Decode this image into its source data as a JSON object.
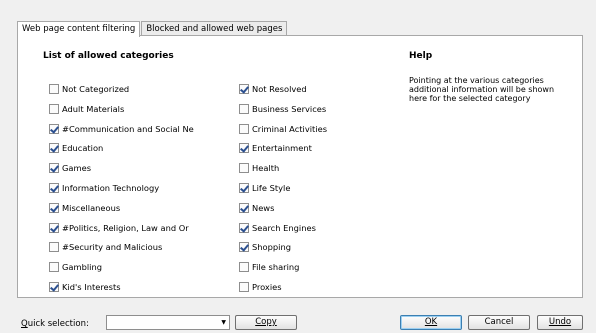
{
  "tabs": [
    {
      "label": "Web page content filtering",
      "active": true
    },
    {
      "label": "Blocked and allowed web pages",
      "active": false
    }
  ],
  "categories_title": "List of allowed categories",
  "left_column": [
    {
      "label": "Not Categorized",
      "checked": false
    },
    {
      "label": "Adult Materials",
      "checked": false
    },
    {
      "label": "#Communication and Social Ne",
      "checked": true
    },
    {
      "label": "Education",
      "checked": true
    },
    {
      "label": "Games",
      "checked": true
    },
    {
      "label": "Information Technology",
      "checked": true
    },
    {
      "label": "Miscellaneous",
      "checked": true
    },
    {
      "label": "#Politics, Religion, Law and Or",
      "checked": true
    },
    {
      "label": "#Security and Malicious",
      "checked": false
    },
    {
      "label": "Gambling",
      "checked": false
    },
    {
      "label": "Kid's Interests",
      "checked": true
    }
  ],
  "right_column": [
    {
      "label": "Not Resolved",
      "checked": true
    },
    {
      "label": "Business Services",
      "checked": false
    },
    {
      "label": "Criminal Activities",
      "checked": false
    },
    {
      "label": "Entertainment",
      "checked": true
    },
    {
      "label": "Health",
      "checked": false
    },
    {
      "label": "Life Style",
      "checked": true
    },
    {
      "label": "News",
      "checked": true
    },
    {
      "label": "Search Engines",
      "checked": true
    },
    {
      "label": "Shopping",
      "checked": true
    },
    {
      "label": "File sharing",
      "checked": false
    },
    {
      "label": "Proxies",
      "checked": false
    }
  ],
  "help": {
    "title": "Help",
    "text": "Pointing at the various categories additional information will be shown here for the selected category"
  },
  "bottom": {
    "quick_selection_label": "Quick selection:",
    "quick_selection_value": "",
    "copy_label": "Copy",
    "ok_label": "OK",
    "cancel_label": "Cancel",
    "undo_label": "Undo"
  }
}
